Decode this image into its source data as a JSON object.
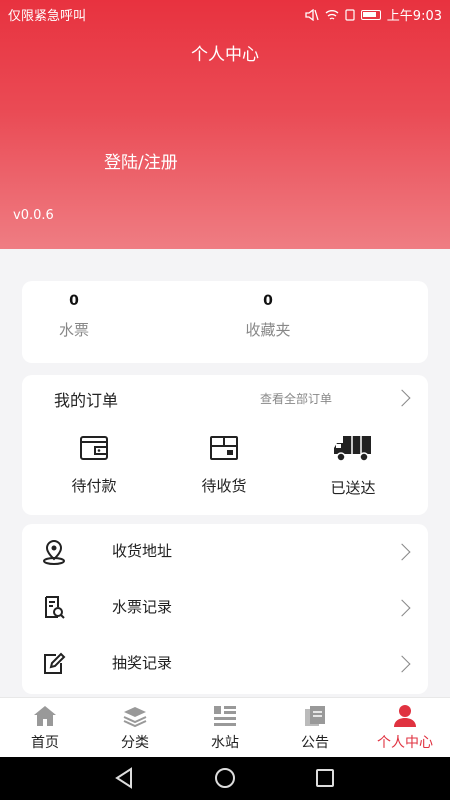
{
  "status_bar": {
    "left_text": "仅限紧急呼叫",
    "time": "上午9:03"
  },
  "header": {
    "title": "个人中心",
    "login": "登陆/注册",
    "version": "v0.0.6"
  },
  "stats": [
    {
      "value": "0",
      "label": "水票"
    },
    {
      "value": "0",
      "label": "收藏夹"
    }
  ],
  "orders": {
    "title": "我的订单",
    "view_all": "查看全部订单",
    "items": [
      {
        "label": "待付款",
        "icon": "wallet-icon"
      },
      {
        "label": "待收货",
        "icon": "box-icon"
      },
      {
        "label": "已送达",
        "icon": "truck-icon"
      }
    ]
  },
  "menu": [
    {
      "label": "收货地址",
      "icon": "location-icon"
    },
    {
      "label": "水票记录",
      "icon": "document-search-icon"
    },
    {
      "label": "抽奖记录",
      "icon": "edit-icon"
    }
  ],
  "tabs": [
    {
      "label": "首页",
      "icon": "home-icon"
    },
    {
      "label": "分类",
      "icon": "layers-icon"
    },
    {
      "label": "水站",
      "icon": "grid-icon"
    },
    {
      "label": "公告",
      "icon": "clipboard-icon"
    },
    {
      "label": "个人中心",
      "icon": "user-icon",
      "active": true
    }
  ],
  "colors": {
    "accent": "#e03240",
    "header_top": "#e8323f",
    "header_bottom": "#ef7d83"
  }
}
